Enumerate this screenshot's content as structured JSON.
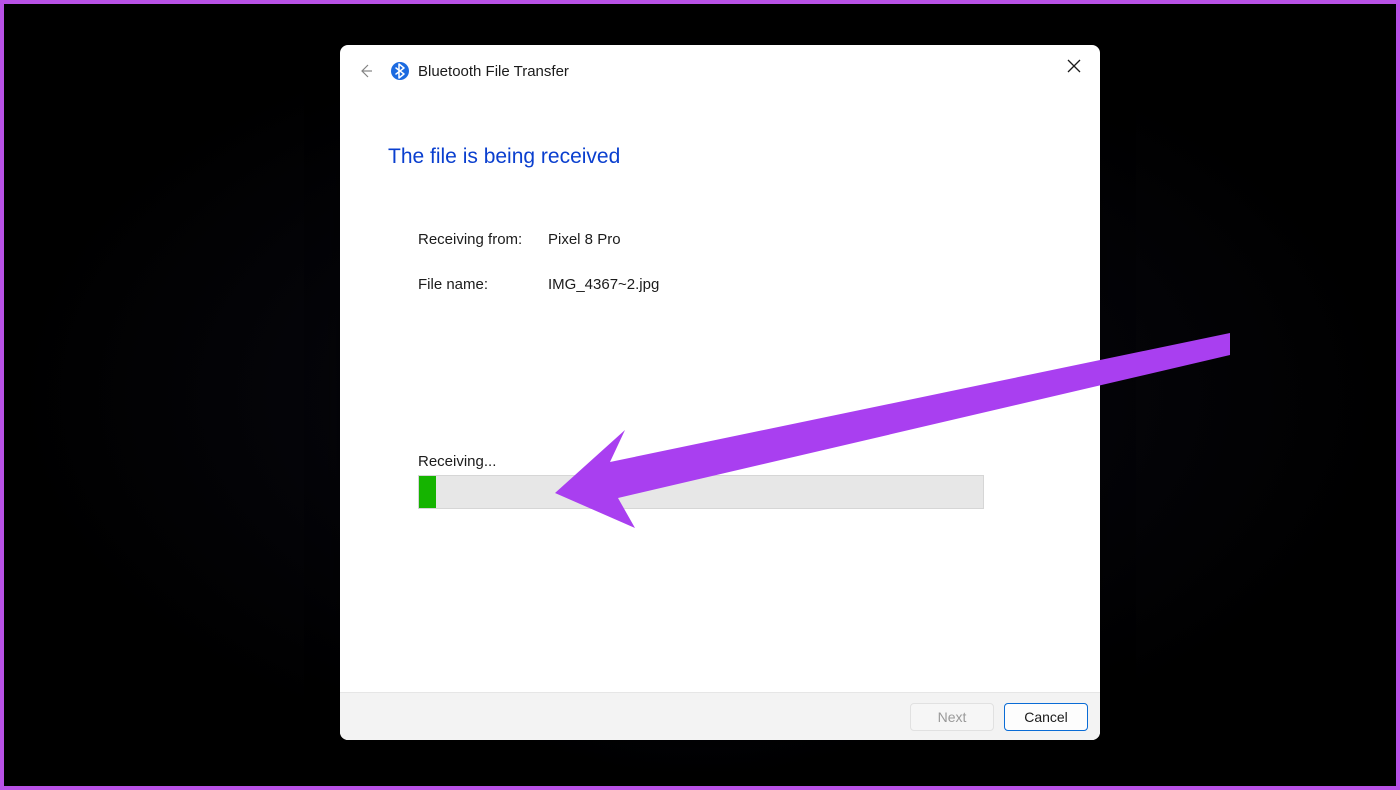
{
  "dialog": {
    "title": "Bluetooth File Transfer",
    "heading": "The file is being received",
    "receiving_from_label": "Receiving from:",
    "receiving_from_value": "Pixel 8 Pro",
    "file_name_label": "File name:",
    "file_name_value": "IMG_4367~2.jpg",
    "progress_label": "Receiving...",
    "progress_percent": 3,
    "next_button": "Next",
    "cancel_button": "Cancel"
  },
  "colors": {
    "accent_purple": "#b952e6",
    "heading_blue": "#0a3fcf",
    "progress_green": "#15b400",
    "cancel_border": "#0a6cd6"
  }
}
